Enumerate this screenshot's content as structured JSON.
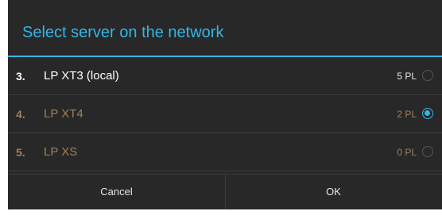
{
  "dialog": {
    "title": "Select server on the network",
    "accent_color": "#33b5e5",
    "servers": [
      {
        "number": "3.",
        "name": "LP XT3 (local)",
        "players": "5 PL",
        "selected": false
      },
      {
        "number": "4.",
        "name": "LP XT4",
        "players": "2 PL",
        "selected": true
      },
      {
        "number": "5.",
        "name": "LP XS",
        "players": "0 PL",
        "selected": false
      }
    ],
    "buttons": {
      "cancel_label": "Cancel",
      "ok_label": "OK"
    }
  }
}
